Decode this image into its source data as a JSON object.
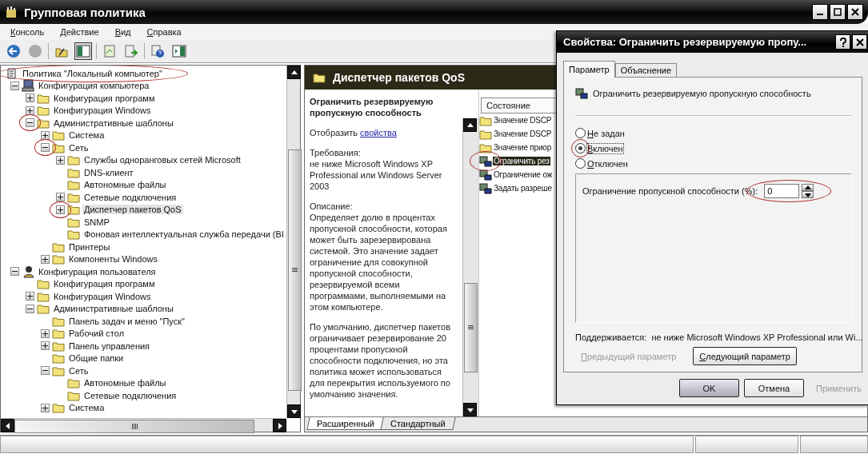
{
  "window": {
    "title": "Групповая политика"
  },
  "menu": [
    "Консоль",
    "Действие",
    "Вид",
    "Справка"
  ],
  "tree": [
    {
      "label": "Политика \"Локальный компьютер\"",
      "kind": "root",
      "selected": false,
      "circled": true,
      "children": [
        {
          "label": "Конфигурация компьютера",
          "kind": "computer",
          "expanded": true,
          "selected": false,
          "circled": false,
          "children": [
            {
              "label": "Конфигурация программ",
              "kind": "folder",
              "expanded": false,
              "selected": false,
              "circled": false
            },
            {
              "label": "Конфигурация Windows",
              "kind": "folder",
              "expanded": false,
              "selected": false,
              "circled": false
            },
            {
              "label": "Административные шаблоны",
              "kind": "folder",
              "expanded": true,
              "selected": false,
              "circled": true,
              "children": [
                {
                  "label": "Система",
                  "kind": "folder",
                  "expanded": false,
                  "selected": false,
                  "circled": false
                },
                {
                  "label": "Сеть",
                  "kind": "folder",
                  "expanded": true,
                  "selected": false,
                  "circled": true,
                  "children": [
                    {
                      "label": "Службы одноранговых сетей Microsoft",
                      "kind": "folder",
                      "expanded": false,
                      "selected": false,
                      "circled": false
                    },
                    {
                      "label": "DNS-клиент",
                      "kind": "folder",
                      "selected": false,
                      "circled": false
                    },
                    {
                      "label": "Автономные файлы",
                      "kind": "folder",
                      "selected": false,
                      "circled": false
                    },
                    {
                      "label": "Сетевые подключения",
                      "kind": "folder",
                      "expanded": false,
                      "selected": false,
                      "circled": false
                    },
                    {
                      "label": "Диспетчер пакетов QoS",
                      "kind": "folder",
                      "expanded": false,
                      "selected": true,
                      "circled": true
                    },
                    {
                      "label": "SNMP",
                      "kind": "folder",
                      "selected": false,
                      "circled": false
                    },
                    {
                      "label": "Фоновая интеллектуальная служба передачи (BI",
                      "kind": "folder",
                      "selected": false,
                      "circled": false
                    }
                  ]
                },
                {
                  "label": "Принтеры",
                  "kind": "folder",
                  "selected": false,
                  "circled": false
                },
                {
                  "label": "Компоненты Windows",
                  "kind": "folder",
                  "expanded": false,
                  "selected": false,
                  "circled": false
                }
              ]
            }
          ]
        },
        {
          "label": "Конфигурация пользователя",
          "kind": "user",
          "expanded": true,
          "selected": false,
          "circled": false,
          "children": [
            {
              "label": "Конфигурация программ",
              "kind": "folder",
              "selected": false,
              "circled": false
            },
            {
              "label": "Конфигурация Windows",
              "kind": "folder",
              "expanded": false,
              "selected": false,
              "circled": false
            },
            {
              "label": "Административные шаблоны",
              "kind": "folder",
              "expanded": true,
              "selected": false,
              "circled": false,
              "children": [
                {
                  "label": "Панель задач и меню \"Пуск\"",
                  "kind": "folder",
                  "selected": false,
                  "circled": false
                },
                {
                  "label": "Рабочий стол",
                  "kind": "folder",
                  "expanded": false,
                  "selected": false,
                  "circled": false
                },
                {
                  "label": "Панель управления",
                  "kind": "folder",
                  "expanded": false,
                  "selected": false,
                  "circled": false
                },
                {
                  "label": "Общие папки",
                  "kind": "folder",
                  "selected": false,
                  "circled": false
                },
                {
                  "label": "Сеть",
                  "kind": "folder",
                  "expanded": true,
                  "selected": false,
                  "circled": false,
                  "children": [
                    {
                      "label": "Автономные файлы",
                      "kind": "folder",
                      "selected": false,
                      "circled": false
                    },
                    {
                      "label": "Сетевые подключения",
                      "kind": "folder",
                      "selected": false,
                      "circled": false
                    }
                  ]
                },
                {
                  "label": "Система",
                  "kind": "folder",
                  "expanded": false,
                  "selected": false,
                  "circled": false
                }
              ]
            }
          ]
        }
      ]
    }
  ],
  "result": {
    "header": "Диспетчер пакетов QoS",
    "description": {
      "title": "Ограничить резервируемую пропускную способность",
      "show_prefix": "Отобразить",
      "show_link": "свойства",
      "requirements_label": "Требования:",
      "requirements": "не ниже Microsoft Windows XP Professional или Windows Server 2003",
      "description_label": "Описание:",
      "paragraphs": [
        "Определяет долю в процентах пропускной способности, которая может быть зарезервирована системой. Это значение задает ограничение для совокупной пропускной способности, резервируемой всеми программами, выполняемыми на этом компьютере.",
        "По умолчанию, диспетчер пакетов ограничивает резервирование 20 процентами пропускной способности подключения, но эта политика может использоваться для перекрытия используемого по умолчанию значения."
      ]
    },
    "list": {
      "column": "Состояние",
      "items": [
        {
          "label": "Значение DSCP",
          "kind": "folder",
          "selected": false,
          "circled": false
        },
        {
          "label": "Значение DSCP",
          "kind": "folder",
          "selected": false,
          "circled": false
        },
        {
          "label": "Значение приор",
          "kind": "folder",
          "selected": false,
          "circled": false
        },
        {
          "label": "Ограничить рез",
          "kind": "setting",
          "selected": true,
          "circled": true
        },
        {
          "label": "Ограничение ож",
          "kind": "setting",
          "selected": false,
          "circled": false
        },
        {
          "label": "Задать разреше",
          "kind": "setting",
          "selected": false,
          "circled": false
        }
      ]
    },
    "view_tabs": [
      {
        "label": "Расширенный",
        "selected": true
      },
      {
        "label": "Стандартный",
        "selected": false
      }
    ]
  },
  "dialog": {
    "title": "Свойства: Ограничить резервируемую пропу...",
    "tabs": [
      {
        "label": "Параметр",
        "selected": true
      },
      {
        "label": "Объяснение",
        "selected": false
      }
    ],
    "setting_name": "Ограничить резервируемую пропускную способность",
    "options": [
      {
        "label": "Не задан",
        "selected": false,
        "circled": false
      },
      {
        "label": "Включен",
        "selected": true,
        "circled": true
      },
      {
        "label": "Отключен",
        "selected": false,
        "circled": false
      }
    ],
    "limit": {
      "label": "Ограничение пропускной способности (%):",
      "value": "0",
      "circled": true
    },
    "supported": {
      "label": "Поддерживается:",
      "value": "не ниже Microsoft Windows XP Professional или Wi..."
    },
    "nav_buttons": [
      {
        "label": "Предыдущий параметр",
        "disabled": true
      },
      {
        "label": "Следующий параметр",
        "disabled": false
      }
    ],
    "buttons": [
      {
        "label": "OK",
        "disabled": false,
        "default": true
      },
      {
        "label": "Отмена",
        "disabled": false,
        "default": false
      },
      {
        "label": "Применить",
        "disabled": true,
        "default": false
      }
    ]
  }
}
